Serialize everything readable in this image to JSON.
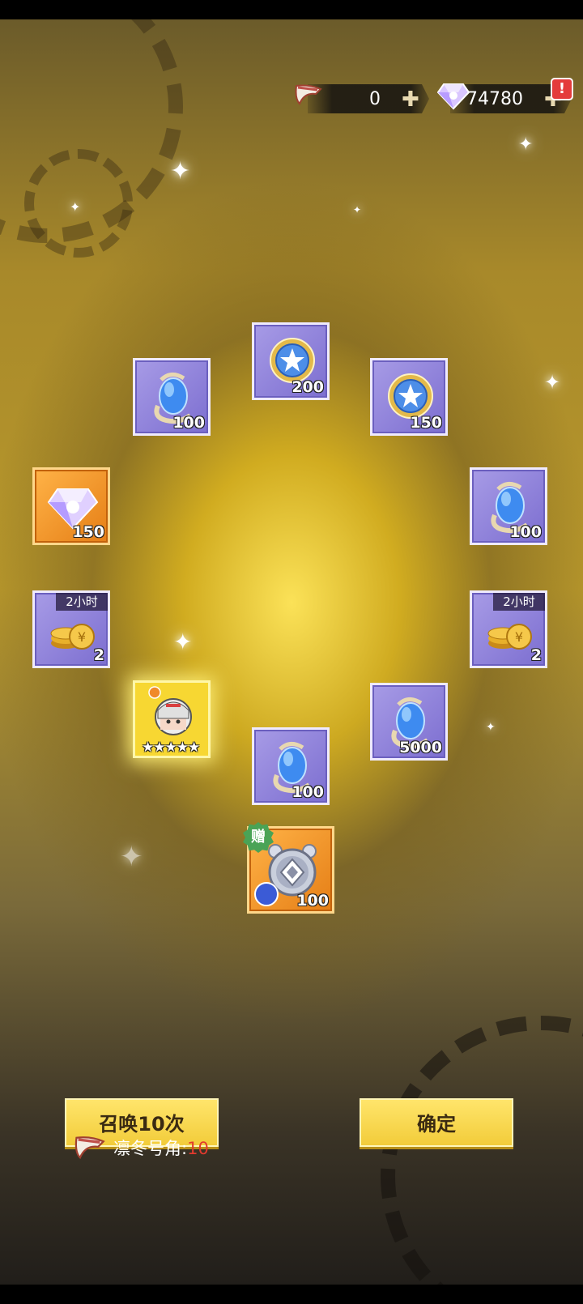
{
  "hud": {
    "horn": {
      "icon": "horn-icon",
      "value": "0"
    },
    "crystal": {
      "icon": "crystal-icon",
      "value": "74780"
    },
    "alert": "!"
  },
  "rewards": [
    {
      "id": "egg-1",
      "icon": "blue-egg-icon",
      "count": "100",
      "frame": "purple"
    },
    {
      "id": "medal-1",
      "icon": "star-medal-icon",
      "count": "200",
      "frame": "purple"
    },
    {
      "id": "medal-2",
      "icon": "star-medal-icon",
      "count": "150",
      "frame": "purple"
    },
    {
      "id": "crystal-1",
      "icon": "crystal-icon",
      "count": "150",
      "frame": "orange"
    },
    {
      "id": "egg-2",
      "icon": "blue-egg-icon",
      "count": "100",
      "frame": "purple"
    },
    {
      "id": "coins-1",
      "icon": "gold-coins-icon",
      "count": "2",
      "duration": "2小时",
      "frame": "purple"
    },
    {
      "id": "coins-2",
      "icon": "gold-coins-icon",
      "count": "2",
      "duration": "2小时",
      "frame": "purple"
    },
    {
      "id": "hero-1",
      "icon": "hero-portrait-icon",
      "stars": "★★★★★",
      "frame": "hero"
    },
    {
      "id": "egg-3",
      "icon": "blue-egg-icon",
      "count": "5000",
      "frame": "purple"
    },
    {
      "id": "egg-4",
      "icon": "blue-egg-icon",
      "count": "100",
      "frame": "purple"
    },
    {
      "id": "bonus-1",
      "icon": "silver-emblem-icon",
      "count": "100",
      "gift": "赠",
      "frame": "orange"
    }
  ],
  "actions": {
    "summon10": "召唤10次",
    "confirm": "确定"
  },
  "cost": {
    "icon": "horn-icon",
    "label": "凛冬号角:",
    "amount": "10"
  },
  "colors": {
    "accent_gold": "#f2cc3a",
    "tile_purple": "#8f82dc",
    "tile_orange": "#f09a2a",
    "cost_red": "#e23a2e"
  }
}
